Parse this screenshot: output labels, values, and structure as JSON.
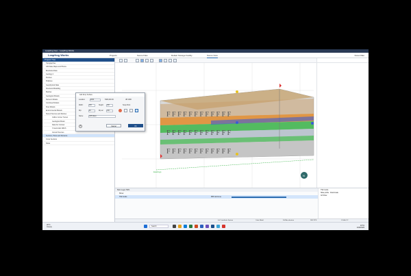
{
  "window": {
    "title": "Leapfrog Geo - Leapfrog Works"
  },
  "appbar": {
    "brand": "Leapfrog Works",
    "tabs": [
      "Projects",
      "Scene Files",
      "Deltaic Storage Facility",
      "Scene View"
    ],
    "user": "Koren Rao"
  },
  "sidebar": {
    "title": "Project Tree",
    "items": [
      {
        "label": "Topographies"
      },
      {
        "label": "GIS Data, Maps and Photos"
      },
      {
        "label": "Boreholes Data"
      },
      {
        "label": "Geology C"
      },
      {
        "label": "Pennies"
      },
      {
        "label": "Polylines"
      },
      {
        "label": "Geophysical Data"
      },
      {
        "label": "Structural Modelling"
      },
      {
        "label": "Meshes"
      },
      {
        "label": "Geological Models"
      },
      {
        "label": "Numeric Models"
      },
      {
        "label": "Combined Models"
      },
      {
        "label": "Flow Models"
      },
      {
        "label": "Environmental Models"
      },
      {
        "label": "Stored Sources and Meshes"
      },
      {
        "label": "Collins Corner Tunnel",
        "indent": true
      },
      {
        "label": "Geological Model",
        "indent": true
      },
      {
        "label": "Data For Contour",
        "indent": true
      },
      {
        "label": "3 Geomodel GMLS",
        "indent": true
      },
      {
        "label": "Ground Sources",
        "indent": true
      },
      {
        "label": "Sections, Plans and Divisions",
        "selected": true
      },
      {
        "label": "Cross Sections"
      },
      {
        "label": "Notes"
      }
    ]
  },
  "viewport": {
    "axis_label": "Eastings",
    "compass": "N",
    "scale_text": "Plunge 12\nAzimuth 098",
    "scale_bar": "0"
  },
  "dialog": {
    "title": "Add Drop Surface",
    "location_label": "Location:",
    "location_value": "4000",
    "location_value2": "5484,000.00",
    "location_value3": "UB 1900",
    "width_label": "Width:",
    "width_value": "100",
    "height_label": "Height:",
    "height_value": "100",
    "dip_label": "Dip:",
    "dip_value": "90",
    "dip_az_label": "Dip az:",
    "dip_az_value": "130",
    "snap_label": "Snap Point",
    "name_label": "Name:",
    "name_value": "GPM East",
    "cancel": "Cancel",
    "ok": "OK"
  },
  "bottom": {
    "header": "Skim Layer 50%",
    "rows": [
      {
        "label": "Show"
      },
      {
        "label": "TSF Grids",
        "selected": true,
        "value": "955 Grid Line"
      }
    ]
  },
  "rightpanel": {
    "title": "TSF Grids",
    "label": "Slide profile",
    "value": "Final Grade",
    "checkbox": "Gif Show"
  },
  "status": {
    "items": [
      "Init Coordinate System",
      "Code Model",
      "Full Acceleration",
      "DEX FPS",
      "0 Kalib 3.2"
    ]
  },
  "taskbar": {
    "weather_temp": "28°C",
    "weather_text": "Cloudy",
    "search": "Search",
    "time": "10:51",
    "date": "4/06/2025"
  }
}
